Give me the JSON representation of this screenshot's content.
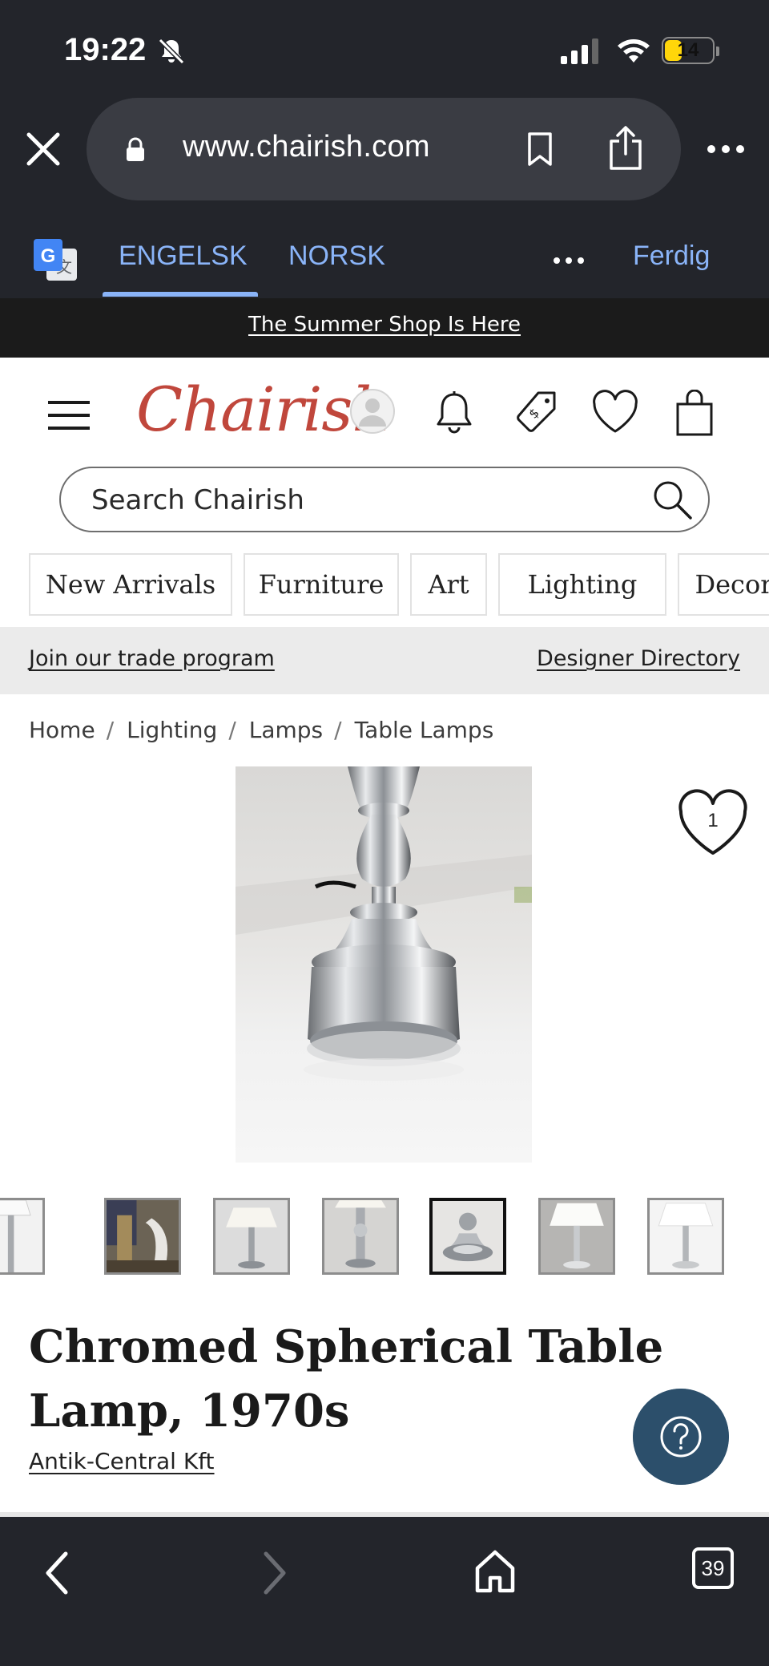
{
  "status_bar": {
    "time": "19:22",
    "battery": "14",
    "battery_level": 0.14
  },
  "browser": {
    "url": "www.chairish.com"
  },
  "translate_bar": {
    "lang_source": "ENGELSK",
    "lang_target": "NORSK",
    "done_label": "Ferdig"
  },
  "promo": {
    "text": "The Summer Shop Is Here"
  },
  "header": {
    "logo": "Chairish"
  },
  "search": {
    "placeholder": "Search Chairish"
  },
  "categories": [
    "New Arrivals",
    "Furniture",
    "Art",
    "Lighting",
    "Decor"
  ],
  "trade": {
    "join": "Join our trade program",
    "directory": "Designer Directory"
  },
  "breadcrumb": [
    "Home",
    "Lighting",
    "Lamps",
    "Table Lamps"
  ],
  "product": {
    "favorites_count": "1",
    "title": "Chromed Spherical Table Lamp, 1970s",
    "seller": "Antik-Central Kft",
    "thumbnail_count": 7,
    "active_thumbnail": 5
  },
  "toolbar": {
    "tab_count": "39"
  },
  "colors": {
    "brand": "#c0473c",
    "browser_chrome": "#23252b",
    "link_blue": "#8ab4f8",
    "help_button": "#2c4f6b"
  },
  "icons": [
    "bell-slash-icon",
    "signal-icon",
    "wifi-icon",
    "close-icon",
    "lock-icon",
    "bookmark-icon",
    "share-icon",
    "more-icon",
    "google-translate-icon",
    "hamburger-icon",
    "account-icon",
    "bell-icon",
    "price-tag-icon",
    "heart-icon",
    "shopping-bag-icon",
    "search-icon",
    "question-icon",
    "back-icon",
    "forward-icon",
    "home-icon"
  ]
}
